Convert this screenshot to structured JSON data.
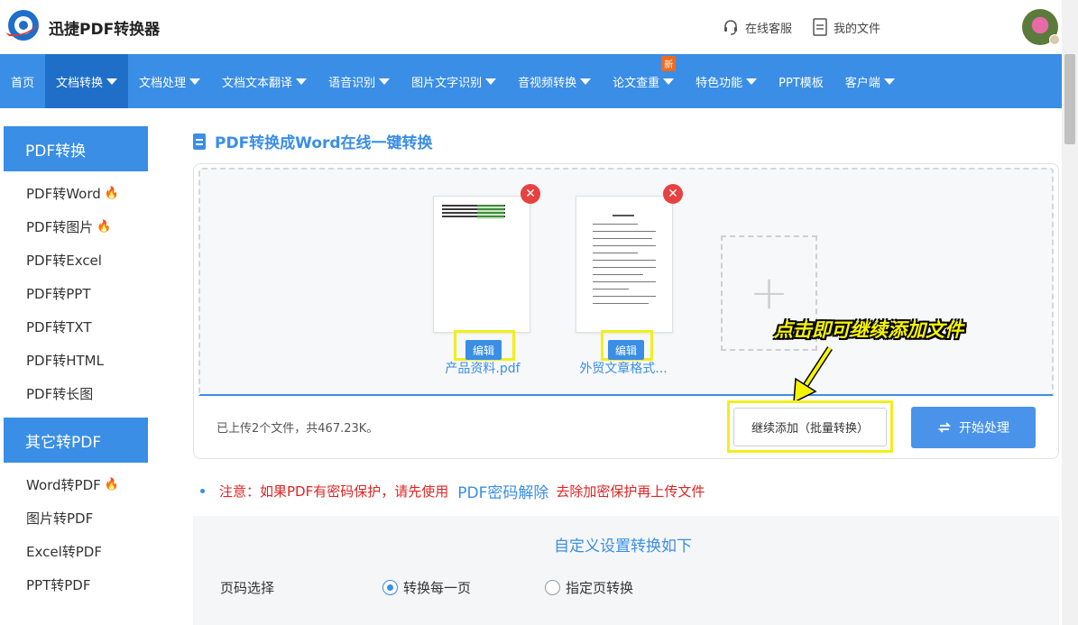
{
  "header": {
    "brand": "迅捷PDF转换器",
    "service_link": "在线客服",
    "files_link": "我的文件"
  },
  "nav": {
    "items": [
      {
        "label": "首页",
        "caret": false
      },
      {
        "label": "文档转换",
        "caret": true,
        "active": true
      },
      {
        "label": "文档处理",
        "caret": true
      },
      {
        "label": "文档文本翻译",
        "caret": true
      },
      {
        "label": "语音识别",
        "caret": true
      },
      {
        "label": "图片文字识别",
        "caret": true
      },
      {
        "label": "音视频转换",
        "caret": true
      },
      {
        "label": "论文查重",
        "caret": true,
        "badge": "新"
      },
      {
        "label": "特色功能",
        "caret": true
      },
      {
        "label": "PPT模板",
        "caret": false
      },
      {
        "label": "客户端",
        "caret": true
      }
    ]
  },
  "sidebar": {
    "pdf_section": {
      "title": "PDF转换",
      "items": [
        {
          "label": "PDF转Word",
          "hot": true
        },
        {
          "label": "PDF转图片",
          "hot": true
        },
        {
          "label": "PDF转Excel",
          "hot": false
        },
        {
          "label": "PDF转PPT",
          "hot": false
        },
        {
          "label": "PDF转TXT",
          "hot": false
        },
        {
          "label": "PDF转HTML",
          "hot": false
        },
        {
          "label": "PDF转长图",
          "hot": false
        }
      ]
    },
    "other_section": {
      "title": "其它转PDF",
      "items": [
        {
          "label": "Word转PDF",
          "hot": true
        },
        {
          "label": "图片转PDF",
          "hot": false
        },
        {
          "label": "Excel转PDF",
          "hot": false
        },
        {
          "label": "PPT转PDF",
          "hot": false
        }
      ]
    }
  },
  "main": {
    "title": "PDF转换成Word在线一键转换",
    "files": [
      {
        "name": "产品资料.pdf",
        "edit_label": "编辑"
      },
      {
        "name": "外贸文章格式...",
        "edit_label": "编辑"
      }
    ],
    "callout": "点击即可继续添加文件",
    "upload_info": "已上传2个文件，共467.23K。",
    "add_more_label": "继续添加（批量转换）",
    "start_label": "开始处理",
    "notice_prefix": "注意：如果PDF有密码保护，请先使用",
    "notice_link": "PDF密码解除",
    "notice_suffix": "去除加密保护再上传文件",
    "settings_title": "自定义设置转换如下",
    "page_select_label": "页码选择",
    "radio_all": "转换每一页",
    "radio_specific": "指定页转换"
  },
  "colors": {
    "primary": "#3a8ee6",
    "nav_active": "#1f6fc8",
    "highlight": "#f0ef1a",
    "danger": "#e84141",
    "notice_red": "#e02424"
  }
}
